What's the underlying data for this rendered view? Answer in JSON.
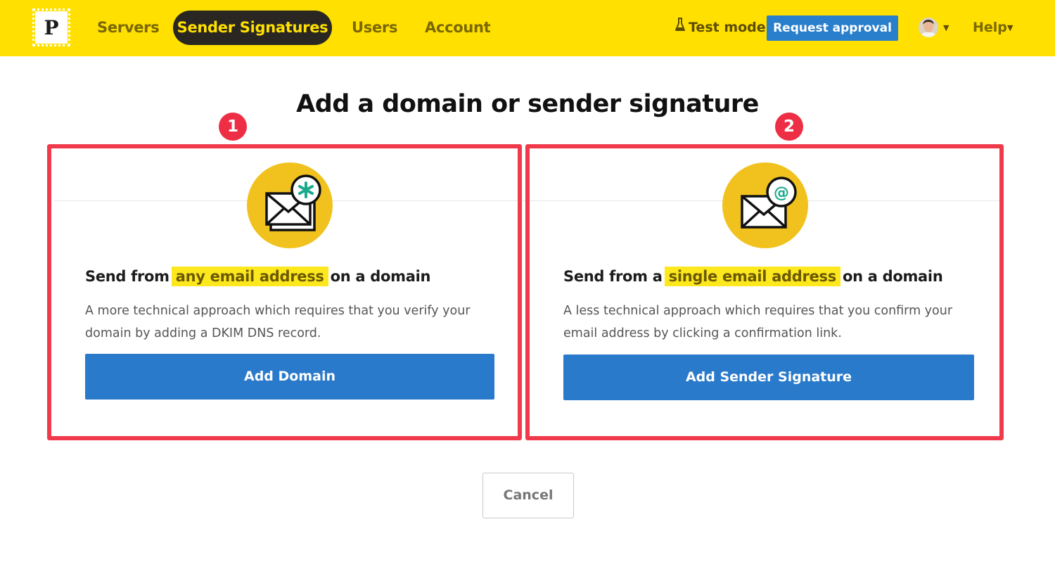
{
  "brand": {
    "logo_letter": "P"
  },
  "nav": {
    "items": [
      {
        "label": "Servers"
      },
      {
        "label": "Sender Signatures"
      },
      {
        "label": "Users"
      },
      {
        "label": "Account"
      }
    ],
    "test_mode_label": "Test mode",
    "request_approval_label": "Request approval",
    "help_label": "Help"
  },
  "page": {
    "title": "Add a domain or sender signature"
  },
  "steps": [
    "1",
    "2"
  ],
  "cards": [
    {
      "title_prefix": "Send from",
      "title_highlight": "any email address",
      "title_suffix": "on a domain",
      "description": "A more technical approach which requires that you verify your domain by adding a DKIM DNS record.",
      "button_label": "Add Domain",
      "icon": "envelope-asterisk-icon"
    },
    {
      "title_prefix": "Send from a",
      "title_highlight": "single email address",
      "title_suffix": "on a domain",
      "description": "A less technical approach which requires that you confirm your email address by clicking a confirmation link.",
      "button_label": "Add Sender Signature",
      "icon": "envelope-at-icon"
    }
  ],
  "cancel_label": "Cancel",
  "colors": {
    "brand_yellow": "#ffe000",
    "nav_active_bg": "#2a2722",
    "primary_blue": "#2a7acb",
    "annotation_red": "#f03a4c",
    "icon_circle": "#f1c21e",
    "highlight": "#fde81e",
    "accent_green": "#1aa98a"
  }
}
